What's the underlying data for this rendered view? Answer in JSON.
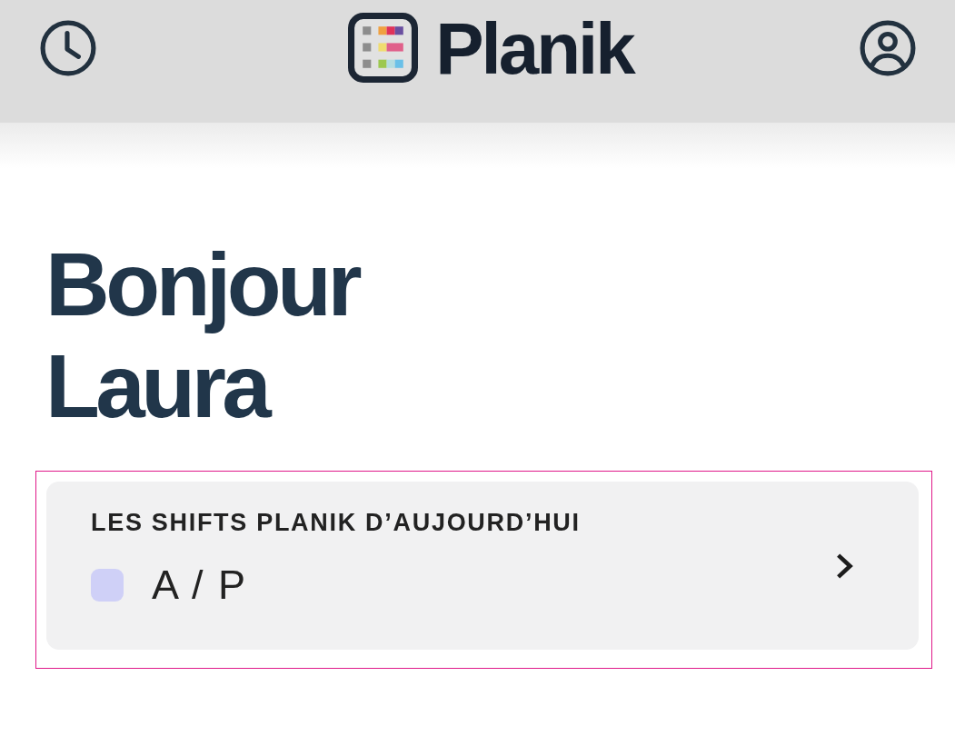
{
  "header": {
    "logo_text": "Planik"
  },
  "greeting": "Bonjour Laura",
  "shifts_card": {
    "title": "LES SHIFTS PLANIK D’AUJOURD’HUI",
    "shifts": [
      {
        "label": "A / P",
        "color": "#cfd0f7"
      }
    ]
  }
}
